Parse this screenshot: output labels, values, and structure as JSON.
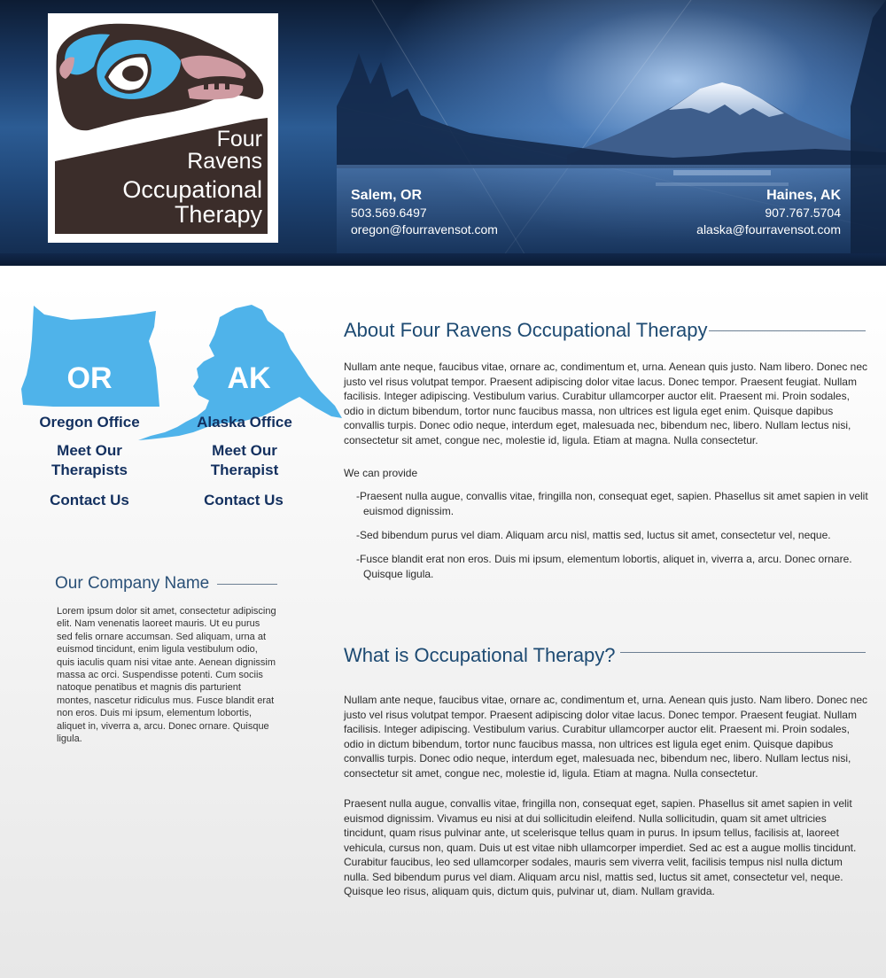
{
  "logo": {
    "line1": "Four",
    "line2": "Ravens",
    "line3": "Occupational",
    "line4": "Therapy"
  },
  "contacts": {
    "oregon": {
      "city": "Salem, OR",
      "phone": "503.569.6497",
      "email": "oregon@fourravensot.com"
    },
    "alaska": {
      "city": "Haines, AK",
      "phone": "907.767.5704",
      "email": "alaska@fourravensot.com"
    }
  },
  "nav": {
    "oregon": {
      "abbr": "OR",
      "office": "Oregon Office",
      "therapists_line1": "Meet Our",
      "therapists_line2": "Therapists",
      "contact": "Contact Us"
    },
    "alaska": {
      "abbr": "AK",
      "office": "Alaska Office",
      "therapists_line1": "Meet Our",
      "therapists_line2": "Therapist",
      "contact": "Contact Us"
    }
  },
  "company": {
    "title": "Our Company Name",
    "text": "Lorem ipsum dolor sit amet, consectetur adipiscing elit. Nam venenatis laoreet mauris. Ut eu purus sed felis ornare accumsan. Sed aliquam, urna at euismod tincidunt, enim ligula vestibulum odio, quis iaculis quam nisi vitae ante. Aenean dignissim massa ac orci. Suspendisse potenti. Cum sociis natoque penatibus et magnis dis parturient montes, nascetur ridiculus mus. Fusce blandit erat non eros. Duis mi ipsum, elementum lobortis, aliquet in, viverra a, arcu. Donec ornare. Quisque ligula."
  },
  "about": {
    "title": "About Four Ravens Occupational Therapy",
    "paragraph": "Nullam ante neque, faucibus vitae, ornare ac, condimentum et, urna. Aenean quis justo. Nam libero. Donec nec justo vel risus volutpat tempor. Praesent adipiscing dolor vitae lacus. Donec tempor. Praesent feugiat. Nullam facilisis. Integer adipiscing. Vestibulum varius. Curabitur ullamcorper auctor elit. Praesent mi. Proin sodales, odio in dictum bibendum, tortor nunc faucibus massa, non ultrices est ligula eget enim. Quisque dapibus convallis turpis. Donec odio neque, interdum eget, malesuada nec, bibendum nec, libero. Nullam lectus nisi, consectetur sit amet, congue nec, molestie id, ligula. Etiam at magna. Nulla consectetur.",
    "provide_label": "We can provide",
    "items": [
      "-Praesent nulla augue, convallis vitae, fringilla non, consequat eget, sapien. Phasellus sit amet sapien in velit euismod dignissim.",
      "-Sed bibendum purus vel diam. Aliquam arcu nisl, mattis sed, luctus sit amet, consectetur vel, neque.",
      "-Fusce blandit erat non eros. Duis mi ipsum, elementum lobortis, aliquet in, viverra a, arcu. Donec ornare. Quisque ligula."
    ]
  },
  "ot": {
    "title": "What is Occupational Therapy?",
    "paragraph1": "Nullam ante neque, faucibus vitae, ornare ac, condimentum et, urna. Aenean quis justo. Nam libero. Donec nec justo vel risus volutpat tempor. Praesent adipiscing dolor vitae lacus. Donec tempor. Praesent feugiat. Nullam facilisis. Integer adipiscing. Vestibulum varius. Curabitur ullamcorper auctor elit. Praesent mi. Proin sodales, odio in dictum bibendum, tortor nunc faucibus massa, non ultrices est ligula eget enim. Quisque dapibus convallis turpis. Donec odio neque, interdum eget, malesuada nec, bibendum nec, libero. Nullam lectus nisi, consectetur sit amet, congue nec, molestie id, ligula. Etiam at magna. Nulla consectetur.",
    "paragraph2": "Praesent nulla augue, convallis vitae, fringilla non, consequat eget, sapien. Phasellus sit amet sapien in velit euismod dignissim. Vivamus eu nisi at dui sollicitudin eleifend. Nulla sollicitudin, quam sit amet ultricies tincidunt, quam risus pulvinar ante, ut scelerisque tellus quam in purus. In ipsum tellus, facilisis at, laoreet vehicula, cursus non, quam. Duis ut est vitae nibh ullamcorper imperdiet. Sed ac est a augue mollis tincidunt. Curabitur faucibus, leo sed ullamcorper sodales, mauris sem viverra velit, facilisis tempus nisl nulla dictum nulla. Sed bibendum purus vel diam. Aliquam arcu nisl, mattis sed, luctus sit amet, consectetur vel, neque. Quisque leo risus, aliquam quis, dictum quis, pulvinar ut, diam. Nullam gravida."
  },
  "colors": {
    "header_dark": "#0d1c33",
    "header_mid": "#2c5c94",
    "map_blue": "#4fb3ea",
    "nav_text": "#13305f",
    "heading_text": "#1d4a72",
    "logo_brown": "#3b2d2a",
    "logo_blue": "#48b5e9",
    "logo_pink": "#cf9ba2"
  }
}
